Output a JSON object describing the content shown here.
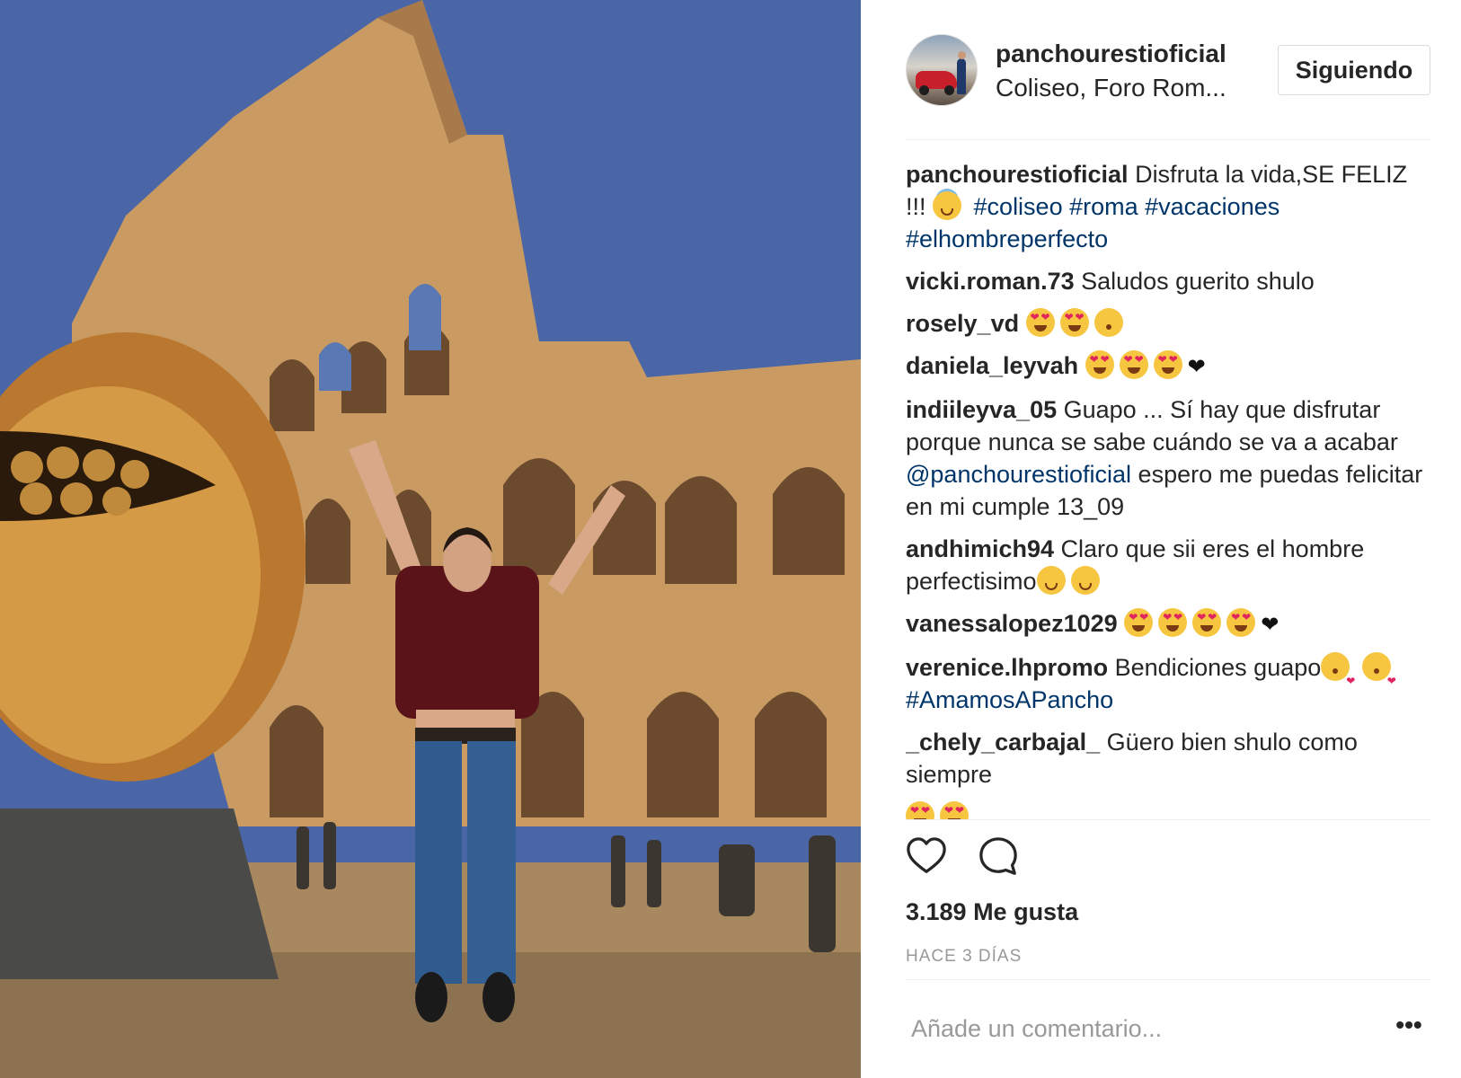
{
  "post": {
    "username": "panchourestioficial",
    "location": "Coliseo, Foro Rom...",
    "follow_label": "Siguiendo",
    "image_alt": "Colosseum photo"
  },
  "caption": {
    "user": "panchourestioficial",
    "text": " Disfruta la vida,SE FELIZ !!! ",
    "tags": "#coliseo #roma #vacaciones #elhombreperfecto"
  },
  "comments": [
    {
      "user": "vicki.roman.73",
      "text": " Saludos guerito shulo"
    },
    {
      "user": "rosely_vd",
      "text": " "
    },
    {
      "user": "daniela_leyvah",
      "text": " "
    },
    {
      "user": "indiileyva_05",
      "text": " Guapo ... Sí hay que disfrutar porque nunca se sabe cuándo se va a acabar ",
      "mention": "@panchourestioficial",
      "text2": " espero me puedas felicitar en mi cumple 13_09"
    },
    {
      "user": "andhimich94",
      "text": " Claro que sii eres el hombre perfectisimo"
    },
    {
      "user": "vanessalopez1029",
      "text": " "
    },
    {
      "user": "verenice.lhpromo",
      "text": " Bendiciones guapo",
      "tag": "#AmamosAPancho"
    },
    {
      "user": "_chely_carbajal_",
      "text": " Güero bien shulo como siempre"
    }
  ],
  "actions": {
    "like_icon": "heart-outline-icon",
    "comment_icon": "comment-bubble-icon"
  },
  "likes_text": "3.189 Me gusta",
  "time_text": "HACE 3 DÍAS",
  "comment_box": {
    "placeholder": "Añade un comentario...",
    "more_label": "•••"
  },
  "colors": {
    "link": "#003569",
    "secondary_text": "#999999",
    "border": "#dbdbdb"
  }
}
